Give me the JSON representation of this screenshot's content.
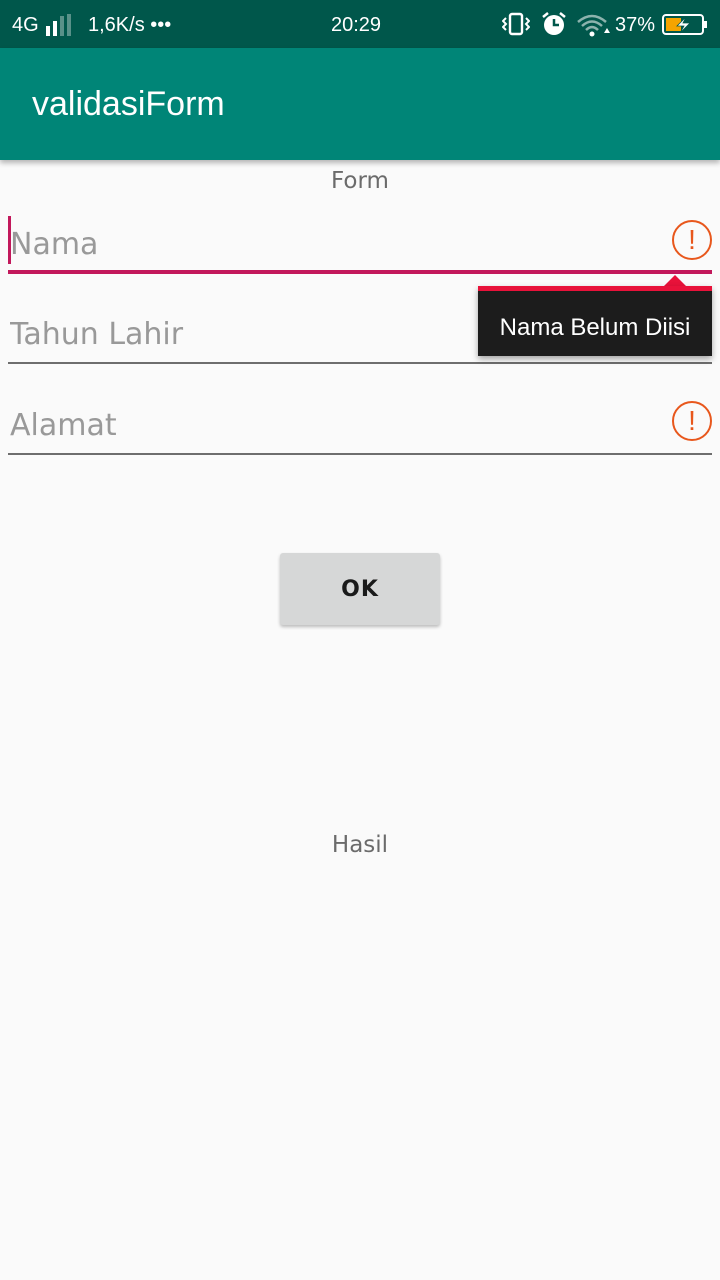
{
  "status_bar": {
    "network": "4G",
    "speed": "1,6K/s •••",
    "time": "20:29",
    "battery_percent": "37%",
    "icons": [
      "signal-icon",
      "vibrate-icon",
      "alarm-icon",
      "wifi-icon",
      "battery-charging-icon"
    ],
    "battery_color": "#f5a400"
  },
  "app_bar": {
    "title": "validasiForm",
    "color": "#008577"
  },
  "form": {
    "heading": "Form",
    "fields": [
      {
        "placeholder": "Nama",
        "value": "",
        "error": true,
        "focused": true
      },
      {
        "placeholder": "Tahun Lahir",
        "value": "",
        "error": true,
        "focused": false
      },
      {
        "placeholder": "Alamat",
        "value": "",
        "error": true,
        "focused": false
      }
    ],
    "error_icon_glyph": "!",
    "error_popup": "Nama Belum Diisi",
    "error_color": "#e8571c",
    "accent_color": "#c2185b"
  },
  "ok_button": {
    "label": "OK"
  },
  "result": {
    "label": "Hasil"
  }
}
